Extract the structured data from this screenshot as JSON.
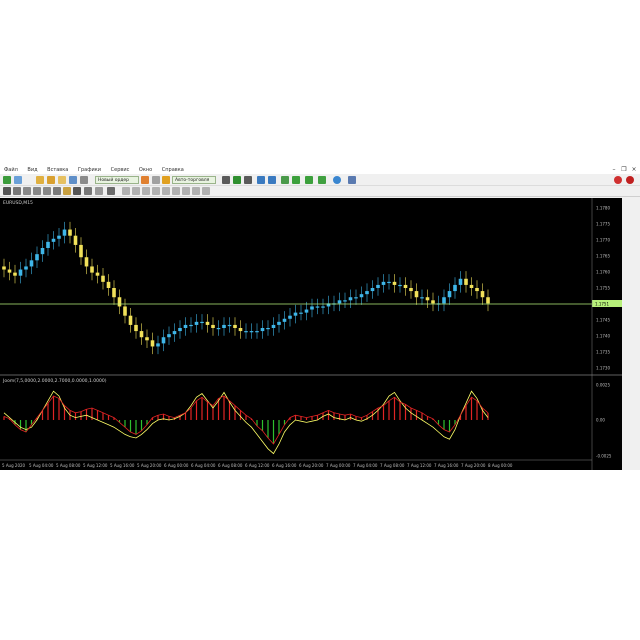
{
  "menu": {
    "items": [
      "Файл",
      "Вид",
      "Вставка",
      "Графики",
      "Сервис",
      "Окно",
      "Справка"
    ]
  },
  "toolbar": {
    "new_order_label": "Новый ордер",
    "autotrading_label": "Авто-торговля"
  },
  "chart": {
    "symbol_label": "EURUSD,M15",
    "price_line_label": "1.1751",
    "price_scale": [
      "1.1780",
      "1.1775",
      "1.1770",
      "1.1765",
      "1.1760",
      "1.1755",
      "1.1750",
      "1.1745",
      "1.1740",
      "1.1735",
      "1.1730"
    ],
    "indicator_label": "Joom(7,5,0000,2.0000,2.7000,0.0000,1.0000)",
    "indicator_scale": [
      "0.0025",
      "0.00",
      "-0.0025"
    ],
    "time_labels": [
      "5 Aug 2020",
      "5 Aug 04:00",
      "5 Aug 08:00",
      "5 Aug 12:00",
      "5 Aug 16:00",
      "5 Aug 20:00",
      "6 Aug 00:00",
      "6 Aug 04:00",
      "6 Aug 08:00",
      "6 Aug 12:00",
      "6 Aug 16:00",
      "6 Aug 20:00",
      "7 Aug 00:00",
      "7 Aug 04:00",
      "7 Aug 08:00",
      "7 Aug 12:00",
      "7 Aug 16:00",
      "7 Aug 20:00",
      "8 Aug 00:00"
    ],
    "colors": {
      "background": "#000000",
      "bull_candle": "#3fb6e8",
      "bear_candle": "#f1e15a",
      "price_line": "#b7f07a",
      "hist_pos": "#e02424",
      "hist_neg": "#2ec02e",
      "signal": "#ffff66"
    }
  },
  "chart_data": {
    "type": "candlestick",
    "closes": [
      1.1762,
      1.1761,
      1.176,
      1.1762,
      1.1763,
      1.1765,
      1.1767,
      1.1769,
      1.1771,
      1.1772,
      1.1773,
      1.1775,
      1.1773,
      1.177,
      1.1766,
      1.1763,
      1.1761,
      1.176,
      1.1758,
      1.1756,
      1.1753,
      1.175,
      1.1747,
      1.1744,
      1.1742,
      1.174,
      1.1739,
      1.1737,
      1.1738,
      1.174,
      1.1741,
      1.1742,
      1.1743,
      1.1744,
      1.1744,
      1.1745,
      1.1745,
      1.1744,
      1.1743,
      1.1743,
      1.1744,
      1.1744,
      1.1743,
      1.1742,
      1.1742,
      1.1742,
      1.1742,
      1.1743,
      1.1743,
      1.1744,
      1.1745,
      1.1746,
      1.1747,
      1.1748,
      1.1748,
      1.1749,
      1.175,
      1.175,
      1.175,
      1.1751,
      1.1751,
      1.1752,
      1.1752,
      1.1753,
      1.1753,
      1.1754,
      1.1755,
      1.1756,
      1.1757,
      1.1758,
      1.1758,
      1.1757,
      1.1757,
      1.1756,
      1.1755,
      1.1753,
      1.1753,
      1.1752,
      1.1751,
      1.1751,
      1.1753,
      1.1755,
      1.1757,
      1.1759,
      1.1757,
      1.1756,
      1.1755,
      1.1753,
      1.1751
    ],
    "series": [
      {
        "name": "histogram",
        "values": [
          0.0003,
          0.0001,
          -0.0004,
          -0.0008,
          -0.001,
          -0.0004,
          0.0002,
          0.0008,
          0.0014,
          0.002,
          0.0018,
          0.0012,
          0.0008,
          0.0006,
          0.0007,
          0.0009,
          0.001,
          0.0008,
          0.0006,
          0.0004,
          0.0002,
          -0.0002,
          -0.0006,
          -0.001,
          -0.0012,
          -0.0009,
          -0.0004,
          0.0002,
          0.0004,
          0.0005,
          0.0003,
          0.0002,
          0.0004,
          0.0006,
          0.001,
          0.0016,
          0.0019,
          0.0015,
          0.0012,
          0.0018,
          0.002,
          0.0016,
          0.0012,
          0.0008,
          0.0004,
          0.0001,
          -0.0005,
          -0.0009,
          -0.0015,
          -0.002,
          -0.0012,
          -0.0004,
          0.0002,
          0.0004,
          0.0003,
          0.0002,
          0.0003,
          0.0004,
          0.0006,
          0.0008,
          0.0006,
          0.0005,
          0.0004,
          0.0005,
          0.0003,
          0.0002,
          0.0004,
          0.0007,
          0.001,
          0.0012,
          0.0016,
          0.0019,
          0.0015,
          0.0013,
          0.001,
          0.0008,
          0.0006,
          0.0003,
          0.0001,
          -0.0004,
          -0.0008,
          -0.001,
          -0.0004,
          0.0004,
          0.0012,
          0.0019,
          0.0016,
          0.001,
          0.0006
        ]
      },
      {
        "name": "signal",
        "values": [
          0.0006,
          0.0002,
          -0.0002,
          -0.0006,
          -0.0008,
          -0.0006,
          0.0,
          0.0008,
          0.0016,
          0.0024,
          0.002,
          0.001,
          0.0004,
          0.0002,
          0.0003,
          0.0004,
          0.0002,
          0.0,
          -0.0002,
          -0.0004,
          -0.0006,
          -0.0009,
          -0.0012,
          -0.0014,
          -0.0015,
          -0.0012,
          -0.0008,
          -0.0003,
          0.0,
          0.0001,
          0.0,
          0.0001,
          0.0003,
          0.0006,
          0.0012,
          0.0019,
          0.0022,
          0.0016,
          0.001,
          0.0016,
          0.0023,
          0.0015,
          0.0008,
          0.0003,
          -0.0002,
          -0.0006,
          -0.0012,
          -0.0018,
          -0.0024,
          -0.0028,
          -0.002,
          -0.001,
          -0.0004,
          0.0,
          -0.0001,
          -0.0002,
          -0.0001,
          0.0,
          0.0003,
          0.0005,
          0.0002,
          0.0001,
          0.0,
          0.0002,
          0.0,
          -0.0001,
          0.0001,
          0.0004,
          0.0008,
          0.0013,
          0.002,
          0.0023,
          0.0016,
          0.001,
          0.0006,
          0.0003,
          0.0,
          -0.0003,
          -0.0006,
          -0.001,
          -0.0014,
          -0.0016,
          -0.0008,
          0.0004,
          0.0014,
          0.0024,
          0.0018,
          0.0008,
          0.0002
        ]
      }
    ],
    "ylim": [
      1.173,
      1.1782
    ],
    "ylim_indicator": [
      -0.003,
      0.003
    ]
  }
}
